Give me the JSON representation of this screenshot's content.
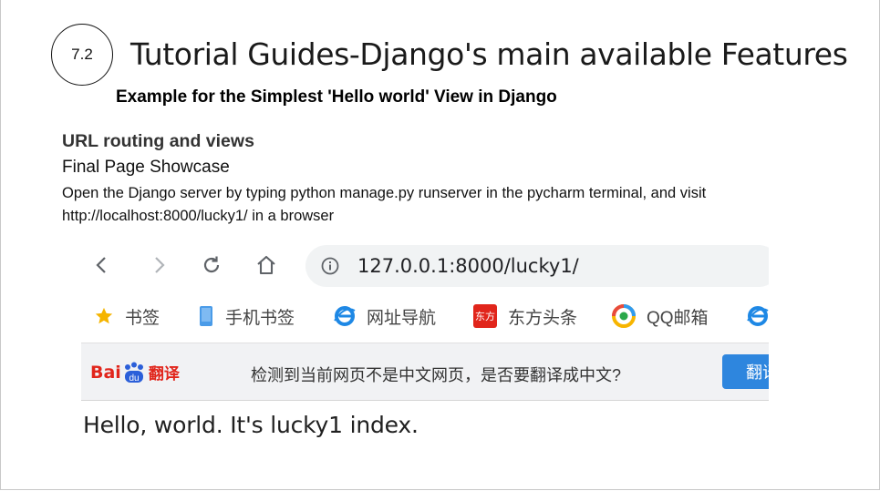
{
  "slide": {
    "number": "7.2",
    "title": "Tutorial Guides-Django's main available Features",
    "subtitle": "Example for the Simplest 'Hello world' View in Django",
    "section_heading": "URL routing and views",
    "showcase_label": "Final Page Showcase",
    "description": "Open the Django server by typing python manage.py runserver in the pycharm terminal, and visit http://localhost:8000/lucky1/ in a browser"
  },
  "browser": {
    "address": "127.0.0.1:8000/lucky1/",
    "bookmarks": [
      {
        "label": "书签",
        "icon": "star-icon"
      },
      {
        "label": "手机书签",
        "icon": "phone-icon"
      },
      {
        "label": "网址导航",
        "icon": "ie-icon"
      },
      {
        "label": "东方头条",
        "icon": "dongfang-icon",
        "icon_text": "东方"
      },
      {
        "label": "QQ邮箱",
        "icon": "qqmail-icon"
      }
    ],
    "translate_bar": {
      "logo_text_left": "Bai",
      "logo_text_right": "翻译",
      "paw_text": "du",
      "message": "检测到当前网页不是中文网页，是否要翻译成中文?",
      "button_label": "翻译"
    },
    "page_content": "Hello, world. It's lucky1 index."
  },
  "colors": {
    "baidu_red": "#e1251b",
    "translate_button": "#2e86de",
    "star": "#f5b400",
    "ie_blue": "#1e88e5"
  }
}
